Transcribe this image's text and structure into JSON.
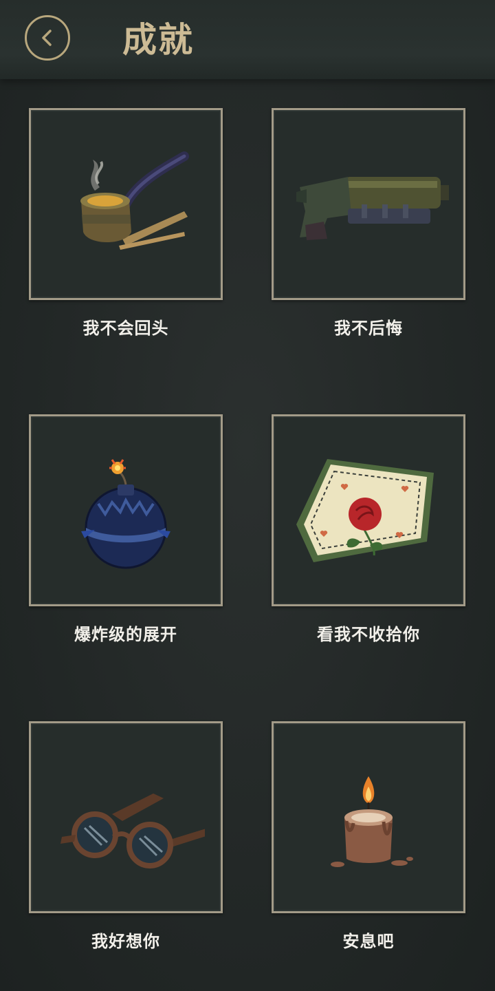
{
  "header": {
    "title": "成就",
    "back_icon": "chevron-left-icon"
  },
  "colors": {
    "accent_gold": "#b8a77d",
    "title": "#cdbb95",
    "card_border": "#a39b88",
    "background": "#232827"
  },
  "achievements": [
    {
      "label": "我不会回头",
      "icon": "pipe-icon"
    },
    {
      "label": "我不后悔",
      "icon": "gun-icon"
    },
    {
      "label": "爆炸级的展开",
      "icon": "bomb-icon"
    },
    {
      "label": "看我不收拾你",
      "icon": "rose-handkerchief-icon"
    },
    {
      "label": "我好想你",
      "icon": "glasses-icon"
    },
    {
      "label": "安息吧",
      "icon": "candle-icon"
    }
  ]
}
